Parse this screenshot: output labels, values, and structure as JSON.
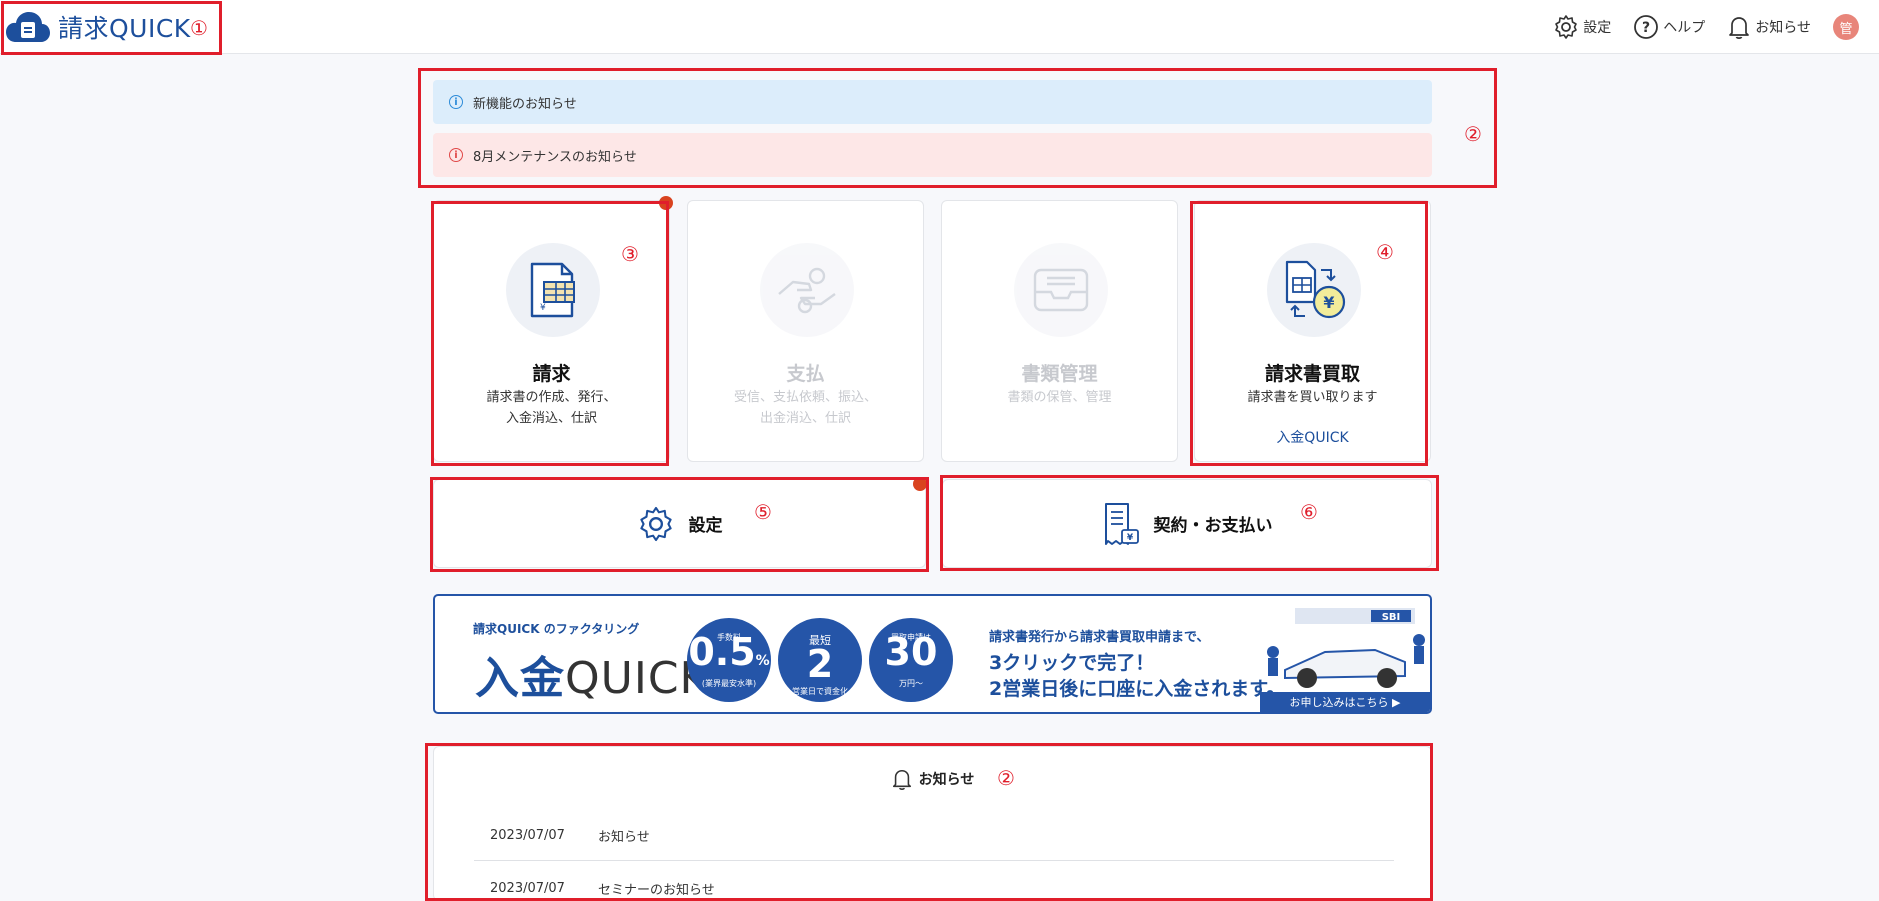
{
  "header": {
    "app_name": "請求QUICK",
    "settings_label": "設定",
    "help_label": "ヘルプ",
    "notice_label": "お知らせ",
    "avatar_text": "管"
  },
  "notices": [
    {
      "text": "新機能のお知らせ",
      "type": "info"
    },
    {
      "text": "8月メンテナンスのお知らせ",
      "type": "warning"
    }
  ],
  "cards": [
    {
      "title": "請求",
      "desc_line1": "請求書の作成、発行、",
      "desc_line2": "入金消込、仕訳",
      "icon": "invoice-icon",
      "enabled": true
    },
    {
      "title": "支払",
      "desc_line1": "受信、支払依頼、振込、",
      "desc_line2": "出金消込、仕訳",
      "icon": "payment-hands-icon",
      "enabled": false
    },
    {
      "title": "書類管理",
      "desc_line1": "書類の保管、管理",
      "desc_line2": "",
      "icon": "inbox-tray-icon",
      "enabled": false
    },
    {
      "title": "請求書買取",
      "desc_line1": "請求書を買い取ります",
      "desc_line2": "",
      "link_label": "入金QUICK",
      "icon": "invoice-purchase-icon",
      "enabled": true
    }
  ],
  "actions": {
    "settings_label": "設定",
    "contract_label": "契約・お支払い"
  },
  "banner": {
    "tagline": "請求QUICK のファクタリング",
    "logo_part1": "入金",
    "logo_part2": "QUICK",
    "fee_caption": "手数料",
    "fee_value": "0.5",
    "fee_unit": "%",
    "fee_note": "(業界最安水準)",
    "days_caption1": "最短",
    "days_value": "2",
    "days_caption2": "営業日で資金化",
    "amount_caption": "買取申請は",
    "amount_value": "30",
    "amount_unit": "万円〜",
    "copy_line1": "請求書発行から請求書買取申請まで、",
    "copy_line2": "3クリックで完了！",
    "copy_line3": "2営業日後に口座に入金されます。",
    "cta_label": "お申し込みはこちら ▶",
    "image_label": "SBI"
  },
  "news": {
    "heading": "お知らせ",
    "items": [
      {
        "date": "2023/07/07",
        "title": "お知らせ"
      },
      {
        "date": "2023/07/07",
        "title": "セミナーのお知らせ"
      }
    ]
  },
  "markers": [
    "①",
    "②",
    "③",
    "④",
    "⑤",
    "⑥",
    "②"
  ],
  "colors": {
    "brand": "#1d4f9c",
    "annotation_red": "#e01e2b",
    "info_bg": "#dcedfb",
    "warn_bg": "#fde7e7"
  }
}
